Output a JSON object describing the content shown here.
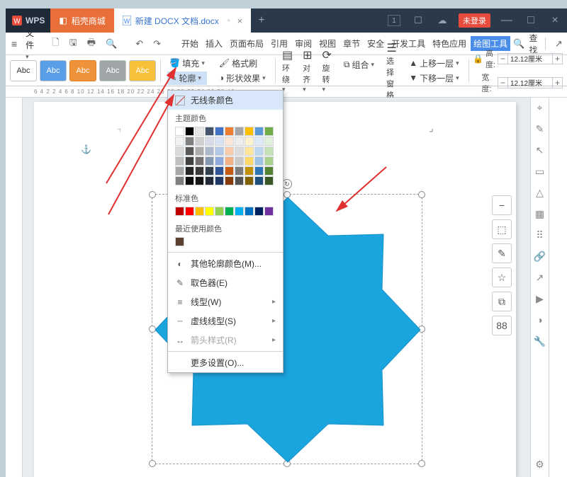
{
  "brand": "WPS",
  "titlebar": {
    "home_tab": "稻壳商城",
    "doc_tab": "新建 DOCX 文档.docx",
    "counter": "1",
    "login": "未登录"
  },
  "menubar": {
    "file": "文件",
    "tabs": [
      "开始",
      "插入",
      "页面布局",
      "引用",
      "审阅",
      "视图",
      "章节",
      "安全",
      "开发工具",
      "特色应用",
      "绘图工具"
    ],
    "active_tab_index": 10,
    "search": "查找"
  },
  "ribbon": {
    "style_label": "Abc",
    "fill": "填充",
    "format_painter": "格式刷",
    "outline": "轮廓",
    "shape_effect": "形状效果",
    "wrap": "环绕",
    "align": "对齐",
    "rotate": "旋转",
    "group": "组合",
    "select_pane": "选择窗格",
    "bring_forward": "上移一层",
    "send_backward": "下移一层",
    "height_label": "高度:",
    "width_label": "宽度:",
    "height_val": "12.12厘米",
    "width_val": "12.12厘米"
  },
  "ruler": "6    4    2        2    4    6    8   10   12   14   16   18   20   22   24   26   28   30   32   34   36   38   40",
  "dropdown": {
    "no_outline": "无线条颜色",
    "theme_colors": "主题颜色",
    "standard_colors": "标准色",
    "recent_colors": "最近使用颜色",
    "more_colors": "其他轮廓颜色(M)...",
    "eyedropper": "取色器(E)",
    "weight": "线型(W)",
    "dashes": "虚线线型(S)",
    "arrows": "箭头样式(R)",
    "more_settings": "更多设置(O)...",
    "theme_swatches": [
      "#ffffff",
      "#000000",
      "#e7e6e6",
      "#44546a",
      "#4472c4",
      "#ed7d31",
      "#a5a5a5",
      "#ffc000",
      "#5b9bd5",
      "#70ad47",
      "#f2f2f2",
      "#808080",
      "#d0cece",
      "#d6dce5",
      "#d9e2f3",
      "#fbe5d6",
      "#ededed",
      "#fff2cc",
      "#deebf7",
      "#e2f0d9",
      "#d9d9d9",
      "#595959",
      "#aeabab",
      "#adb9ca",
      "#b4c7e7",
      "#f7cbac",
      "#dbdbdb",
      "#ffe699",
      "#bdd7ee",
      "#c5e0b4",
      "#bfbfbf",
      "#404040",
      "#757070",
      "#8497b0",
      "#8faadc",
      "#f4b183",
      "#c9c9c9",
      "#ffd966",
      "#9dc3e6",
      "#a9d18e",
      "#a6a6a6",
      "#262626",
      "#3b3838",
      "#323f4f",
      "#2f5597",
      "#c55a11",
      "#7b7b7b",
      "#bf9000",
      "#2e75b6",
      "#548235",
      "#7f7f7f",
      "#0d0d0d",
      "#171616",
      "#222a35",
      "#1f3864",
      "#843c0c",
      "#525252",
      "#806000",
      "#1e4e79",
      "#385723"
    ],
    "standard_swatches": [
      "#c00000",
      "#ff0000",
      "#ffc000",
      "#ffff00",
      "#92d050",
      "#00b050",
      "#00b0f0",
      "#0070c0",
      "#002060",
      "#7030a0"
    ]
  },
  "shape": {
    "fill": "#1ba5de"
  },
  "mini_toolbar": [
    "−",
    "⬚",
    "✎",
    "☆",
    "⧉",
    "88"
  ]
}
